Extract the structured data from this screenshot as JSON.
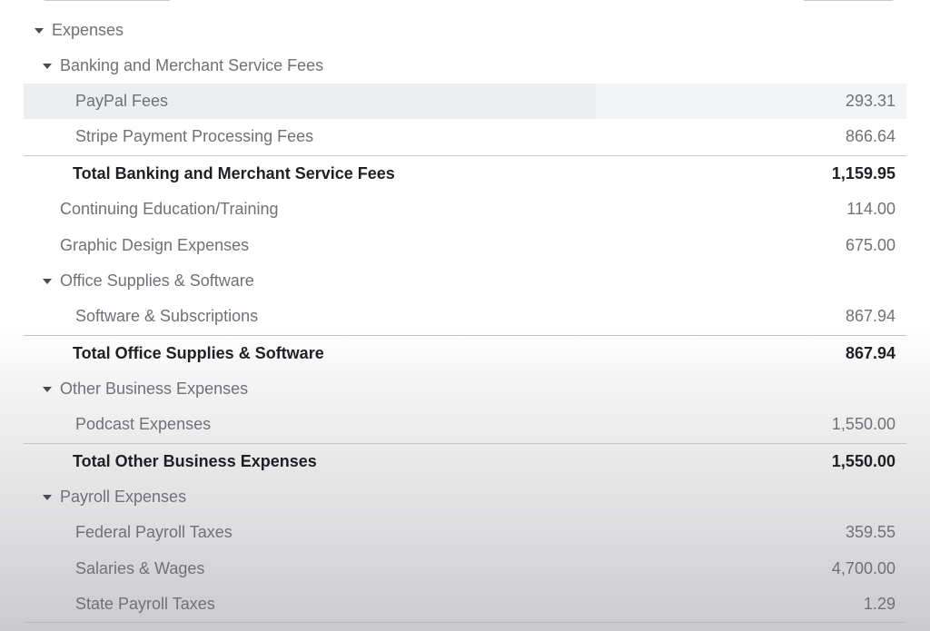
{
  "report": {
    "section_title": "Expenses",
    "groups": [
      {
        "name": "Banking and Merchant Service Fees",
        "items": [
          {
            "label": "PayPal Fees",
            "amount": "293.31"
          },
          {
            "label": "Stripe Payment Processing Fees",
            "amount": "866.64"
          }
        ],
        "total_label": "Total Banking and Merchant Service Fees",
        "total_amount": "1,159.95"
      },
      {
        "name": "Office Supplies & Software",
        "items": [
          {
            "label": "Software & Subscriptions",
            "amount": "867.94"
          }
        ],
        "total_label": "Total Office Supplies & Software",
        "total_amount": "867.94"
      },
      {
        "name": "Other Business Expenses",
        "items": [
          {
            "label": "Podcast Expenses",
            "amount": "1,550.00"
          }
        ],
        "total_label": "Total Other Business Expenses",
        "total_amount": "1,550.00"
      },
      {
        "name": "Payroll Expenses",
        "items": [
          {
            "label": "Federal Payroll Taxes",
            "amount": "359.55"
          },
          {
            "label": "Salaries & Wages",
            "amount": "4,700.00"
          },
          {
            "label": "State Payroll Taxes",
            "amount": "1.29"
          }
        ]
      }
    ],
    "standalone": [
      {
        "label": "Continuing Education/Training",
        "amount": "114.00"
      },
      {
        "label": "Graphic Design Expenses",
        "amount": "675.00"
      }
    ]
  }
}
